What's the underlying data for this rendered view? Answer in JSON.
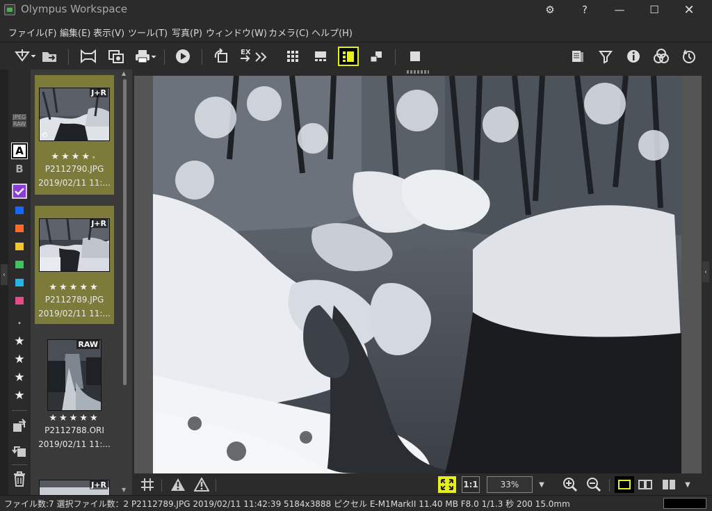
{
  "window": {
    "title": "Olympus Workspace",
    "icons": [
      "settings-icon",
      "help-icon",
      "minimize-icon",
      "maximize-icon",
      "close-icon"
    ]
  },
  "menu": {
    "items": [
      "ファイル(F)",
      "編集(E)",
      "表示(V)",
      "ツール(T)",
      "写真(P)",
      "ウィンドウ(W)",
      "カメラ(C)",
      "ヘルプ(H)"
    ]
  },
  "toolbar": {
    "ex_label": "EX",
    "accent": "#e6f018"
  },
  "leftbar": {
    "jpeg_label": "JPEG",
    "raw_label": "RAW",
    "a_label": "A",
    "b_label": "B",
    "colors": [
      "#1565ff",
      "#ff6a2a",
      "#f5c32a",
      "#3cc65a",
      "#28b3e6",
      "#e84a8a"
    ],
    "check_color": "#8b3bd6"
  },
  "thumbnails": [
    {
      "badge": "J+R",
      "stars": "★★★★",
      "dot": "∘",
      "filename": "P2112790.JPG",
      "date": "2019/02/11 11:...",
      "selected": true
    },
    {
      "badge": "J+R",
      "stars": "★★★★★",
      "dot": "",
      "filename": "P2112789.JPG",
      "date": "2019/02/11 11:...",
      "selected": true
    },
    {
      "badge": "RAW",
      "stars": "★★★★★",
      "dot": "",
      "filename": "P2112788.ORI",
      "date": "2019/02/11 11:...",
      "selected": false
    },
    {
      "badge": "J+R"
    }
  ],
  "viewer": {
    "zoom": "33%",
    "one_to_one": "1:1"
  },
  "status": {
    "text": "ファイル数:7 選択ファイル数：2 P2112789.JPG 2019/02/11 11:42:39 5184x3888 ピクセル E-M1MarkII 11.40 MB F8.0 1/1.3 秒 200 15.0mm"
  }
}
